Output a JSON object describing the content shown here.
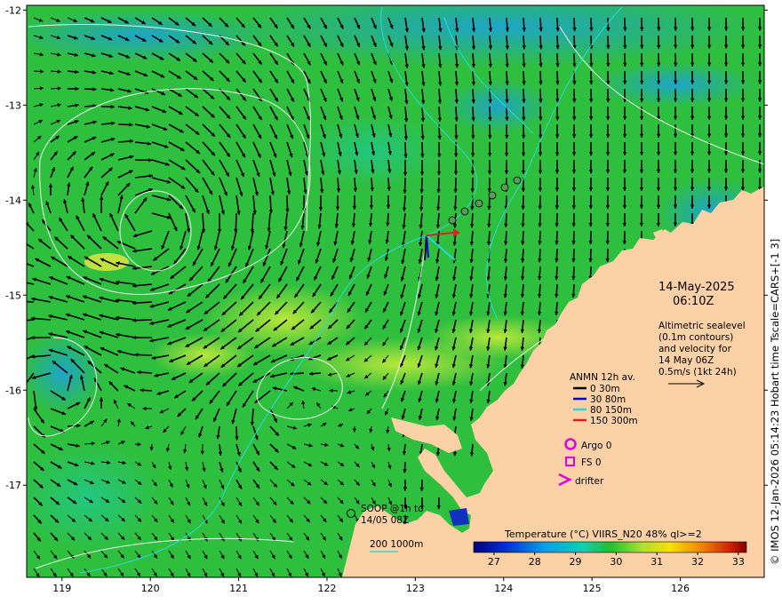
{
  "map": {
    "lon_ticks": [
      "119",
      "120",
      "121",
      "122",
      "123",
      "124",
      "125",
      "126"
    ],
    "lat_ticks": [
      "-12",
      "-13",
      "-14",
      "-15",
      "-16",
      "-17"
    ],
    "lon_range": [
      118.6,
      126.95
    ],
    "lat_range": [
      -17.97,
      -11.95
    ]
  },
  "date_label": "14-May-2025",
  "time_label": "06:10Z",
  "altimetry_note": [
    "Altimetric sealevel",
    "(0.1m contours)",
    "and velocity for",
    "14 May 06Z",
    "0.5m/s (1kt 24h)"
  ],
  "anmn": {
    "title": "ANMN 12h av.",
    "items": [
      {
        "label": "0 30m",
        "color": "#000000"
      },
      {
        "label": "30 80m",
        "color": "#0000cc"
      },
      {
        "label": "80 150m",
        "color": "#22d8d8"
      },
      {
        "label": "150 300m",
        "color": "#e02020"
      }
    ]
  },
  "markers": {
    "argo": "Argo 0",
    "fs": "FS 0",
    "drifter": "drifter"
  },
  "soop": [
    "SOOP @1h to",
    "14/05 08Z"
  ],
  "isobath_label": "200  1000m",
  "colorbar": {
    "title": "Temperature (°C) VIIRS_N20 48% ql>=2",
    "ticks": [
      "27",
      "28",
      "29",
      "30",
      "31",
      "32",
      "33"
    ],
    "range": [
      26.5,
      33.2
    ]
  },
  "credit": "© IMOS 12-Jan-2026 05:14:23 Hobart time Tscale=CARS+[-1 3]",
  "colors": {
    "land": "#fdd1a6",
    "sst_main": "#2fbf3f",
    "sst_warm": "#b9e83a",
    "sst_cool": "#1aa8d8",
    "contour": "#ffffff",
    "isobath": "#29d9d9",
    "magenta": "#e000e0"
  }
}
